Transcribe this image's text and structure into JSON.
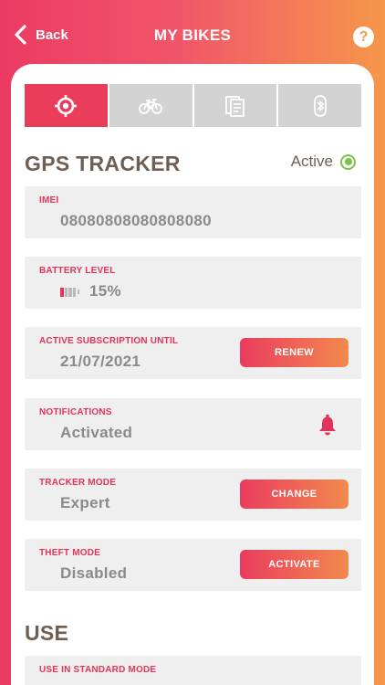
{
  "header": {
    "back_label": "Back",
    "title": "MY BIKES",
    "help_label": "?"
  },
  "tabs": [
    {
      "name": "gps-tracker",
      "icon": "crosshair-icon",
      "active": true
    },
    {
      "name": "bike",
      "icon": "bicycle-icon",
      "active": false
    },
    {
      "name": "documents",
      "icon": "documents-icon",
      "active": false
    },
    {
      "name": "bluetooth",
      "icon": "bluetooth-icon",
      "active": false
    }
  ],
  "gps": {
    "title": "GPS TRACKER",
    "status_label": "Active",
    "imei_label": "IMEI",
    "imei_value": "08080808080808080",
    "battery_label": "BATTERY LEVEL",
    "battery_value": "15%",
    "battery_level": 0.15,
    "subscription_label": "ACTIVE SUBSCRIPTION UNTIL",
    "subscription_value": "21/07/2021",
    "renew_label": "RENEW",
    "notifications_label": "NOTIFICATIONS",
    "notifications_value": "Activated",
    "tracker_mode_label": "TRACKER MODE",
    "tracker_mode_value": "Expert",
    "change_label": "CHANGE",
    "theft_mode_label": "THEFT MODE",
    "theft_mode_value": "Disabled",
    "activate_label": "ACTIVATE"
  },
  "use": {
    "title": "USE",
    "standard_mode_label": "USE IN STANDARD MODE"
  },
  "colors": {
    "accent": "#ea3d5c",
    "gradient_end": "#f6974a",
    "status_green": "#7cc24a",
    "heading_brown": "#6e5f52"
  }
}
